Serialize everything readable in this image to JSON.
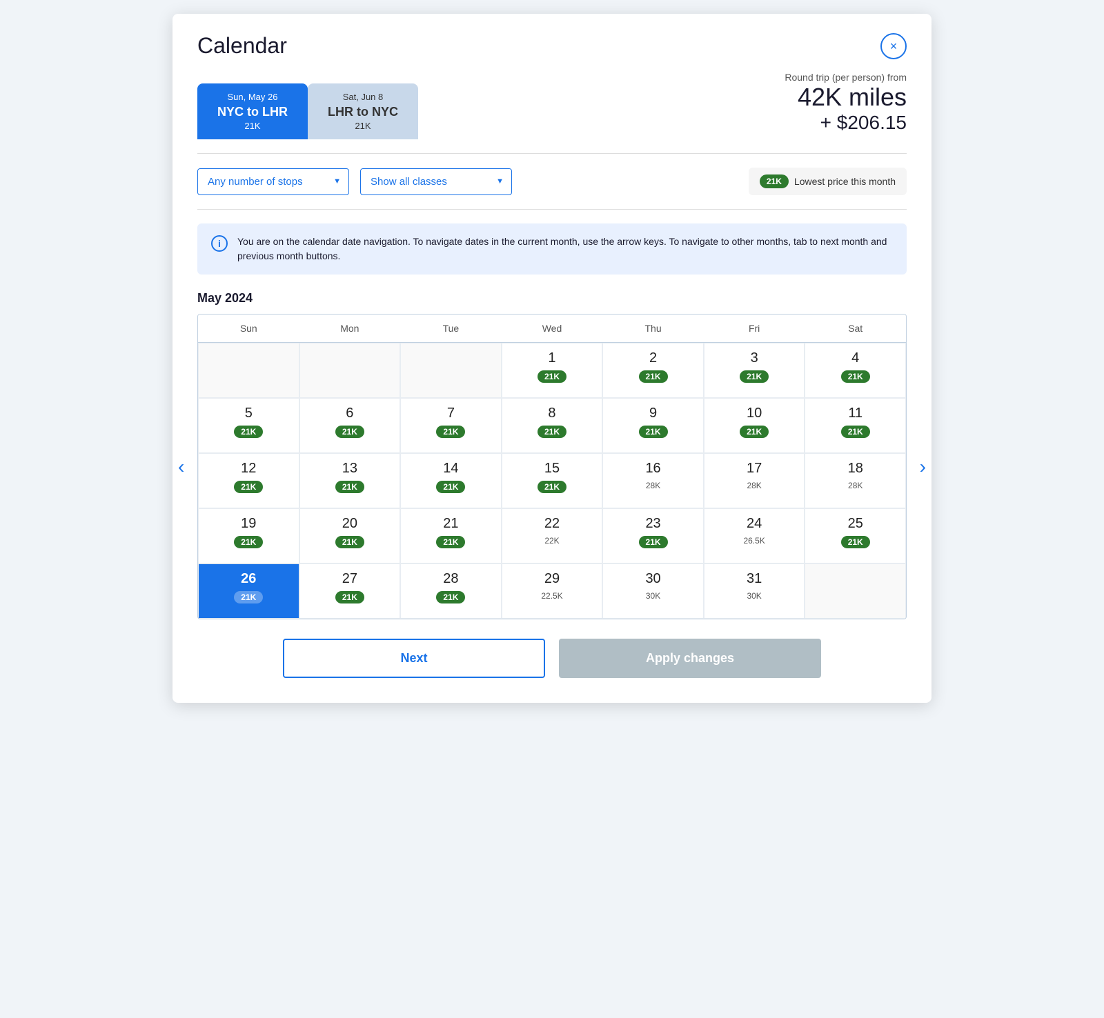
{
  "modal": {
    "title": "Calendar",
    "close_label": "×"
  },
  "tabs": [
    {
      "date": "Sun, May 26",
      "route": "NYC to LHR",
      "miles": "21K",
      "active": true
    },
    {
      "date": "Sat, Jun 8",
      "route": "LHR to NYC",
      "miles": "21K",
      "active": false
    }
  ],
  "price": {
    "label": "Round trip (per person) from",
    "miles": "42K miles",
    "cash": "+ $206.15"
  },
  "filters": {
    "stops_placeholder": "Any number of stops",
    "classes_placeholder": "Show all classes",
    "legend_badge": "21K",
    "legend_text": "Lowest price this month"
  },
  "info": {
    "text": "You are on the calendar date navigation. To navigate dates in the current month, use the arrow keys. To navigate to other months, tab to next month and previous month buttons."
  },
  "calendar": {
    "month_label": "May 2024",
    "weekdays": [
      "Sun",
      "Mon",
      "Tue",
      "Wed",
      "Thu",
      "Fri",
      "Sat"
    ],
    "weeks": [
      [
        {
          "day": "",
          "price": "",
          "type": "empty"
        },
        {
          "day": "",
          "price": "",
          "type": "empty"
        },
        {
          "day": "",
          "price": "",
          "type": "empty"
        },
        {
          "day": "1",
          "price": "21K",
          "type": "green"
        },
        {
          "day": "2",
          "price": "21K",
          "type": "green"
        },
        {
          "day": "3",
          "price": "21K",
          "type": "green"
        },
        {
          "day": "4",
          "price": "21K",
          "type": "green"
        }
      ],
      [
        {
          "day": "5",
          "price": "21K",
          "type": "green"
        },
        {
          "day": "6",
          "price": "21K",
          "type": "green"
        },
        {
          "day": "7",
          "price": "21K",
          "type": "green"
        },
        {
          "day": "8",
          "price": "21K",
          "type": "green"
        },
        {
          "day": "9",
          "price": "21K",
          "type": "green"
        },
        {
          "day": "10",
          "price": "21K",
          "type": "green"
        },
        {
          "day": "11",
          "price": "21K",
          "type": "green"
        }
      ],
      [
        {
          "day": "12",
          "price": "21K",
          "type": "green"
        },
        {
          "day": "13",
          "price": "21K",
          "type": "green"
        },
        {
          "day": "14",
          "price": "21K",
          "type": "green"
        },
        {
          "day": "15",
          "price": "21K",
          "type": "green"
        },
        {
          "day": "16",
          "price": "28K",
          "type": "plain"
        },
        {
          "day": "17",
          "price": "28K",
          "type": "plain"
        },
        {
          "day": "18",
          "price": "28K",
          "type": "plain"
        }
      ],
      [
        {
          "day": "19",
          "price": "21K",
          "type": "green"
        },
        {
          "day": "20",
          "price": "21K",
          "type": "green"
        },
        {
          "day": "21",
          "price": "21K",
          "type": "green"
        },
        {
          "day": "22",
          "price": "22K",
          "type": "plain"
        },
        {
          "day": "23",
          "price": "21K",
          "type": "green"
        },
        {
          "day": "24",
          "price": "26.5K",
          "type": "plain"
        },
        {
          "day": "25",
          "price": "21K",
          "type": "green"
        }
      ],
      [
        {
          "day": "26",
          "price": "21K",
          "type": "selected"
        },
        {
          "day": "27",
          "price": "21K",
          "type": "green"
        },
        {
          "day": "28",
          "price": "21K",
          "type": "green"
        },
        {
          "day": "29",
          "price": "22.5K",
          "type": "plain"
        },
        {
          "day": "30",
          "price": "30K",
          "type": "plain"
        },
        {
          "day": "31",
          "price": "30K",
          "type": "plain"
        },
        {
          "day": "",
          "price": "",
          "type": "faded"
        }
      ]
    ]
  },
  "footer": {
    "next_label": "Next",
    "apply_label": "Apply changes"
  }
}
